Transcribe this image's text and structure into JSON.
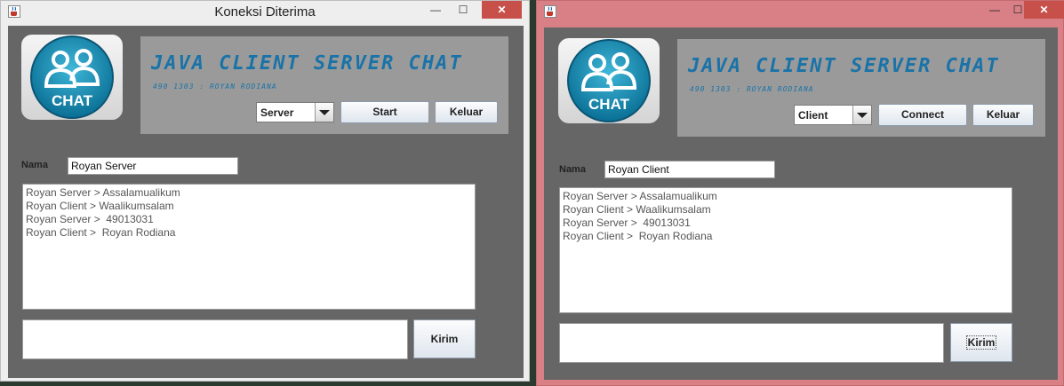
{
  "server": {
    "window_title": "Koneksi Diterima",
    "controls": {
      "minimize": "—",
      "maximize": "☐",
      "close": "✕"
    },
    "logo_text": "CHAT",
    "header_title": "JAVA CLIENT SERVER CHAT",
    "header_subtitle": "490 1303 : ROYAN RODIANA",
    "mode_combo": "Server",
    "action_button": "Start",
    "exit_button": "Keluar",
    "name_label": "Nama",
    "name_value": "Royan Server",
    "messages": [
      "Royan Server > Assalamualikum",
      "Royan Client > Waalikumsalam",
      "Royan Server >  49013031",
      "Royan Client >  Royan Rodiana"
    ],
    "send_button": "Kirim"
  },
  "client": {
    "controls": {
      "minimize": "—",
      "maximize": "☐",
      "close": "✕"
    },
    "logo_text": "CHAT",
    "header_title": "JAVA CLIENT SERVER CHAT",
    "header_subtitle": "490 1303 : ROYAN RODIANA",
    "mode_combo": "Client",
    "action_button": "Connect",
    "exit_button": "Keluar",
    "name_label": "Nama",
    "name_value": "Royan Client",
    "messages": [
      "Royan Server > Assalamualikum",
      "Royan Client > Waalikumsalam",
      "Royan Server >  49013031",
      "Royan Client >  Royan Rodiana"
    ],
    "send_button": "Kirim"
  },
  "colors": {
    "panel_bg": "#666666",
    "header_bg": "#9a9a9a",
    "title_accent": "#1a73a8",
    "client_frame": "#d88085",
    "close_button": "#c7504a"
  },
  "icons": {
    "app": "java-cup-icon",
    "logo": "chat-users-icon"
  }
}
